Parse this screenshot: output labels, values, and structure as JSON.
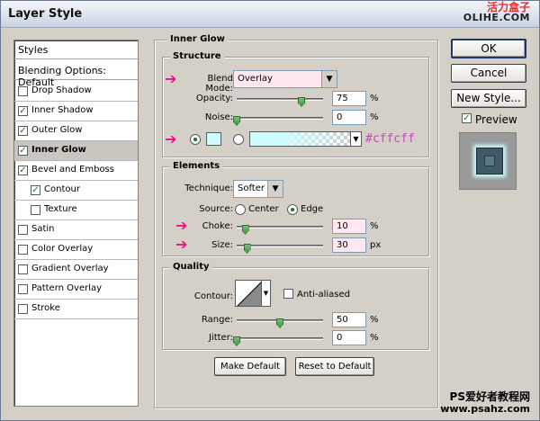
{
  "window": {
    "title": "Layer Style",
    "watermark_top_line1": "活力盒子",
    "watermark_top_line2": "OLIHE.COM",
    "watermark_bottom_line1": "PS爱好者教程网",
    "watermark_bottom_line2": "www.psahz.com"
  },
  "styles_list": {
    "header": "Styles",
    "blending_options": "Blending Options: Default",
    "items": [
      {
        "label": "Drop Shadow",
        "checked": false
      },
      {
        "label": "Inner Shadow",
        "checked": true
      },
      {
        "label": "Outer Glow",
        "checked": true
      },
      {
        "label": "Inner Glow",
        "checked": true,
        "active": true
      },
      {
        "label": "Bevel and Emboss",
        "checked": true
      },
      {
        "label": "Contour",
        "checked": true,
        "indent": true
      },
      {
        "label": "Texture",
        "checked": false,
        "indent": true
      },
      {
        "label": "Satin",
        "checked": false
      },
      {
        "label": "Color Overlay",
        "checked": false
      },
      {
        "label": "Gradient Overlay",
        "checked": false
      },
      {
        "label": "Pattern Overlay",
        "checked": false
      },
      {
        "label": "Stroke",
        "checked": false
      }
    ]
  },
  "inner_glow": {
    "title": "Inner Glow",
    "structure": {
      "title": "Structure",
      "blend_mode_label": "Blend Mode:",
      "blend_mode_value": "Overlay",
      "opacity_label": "Opacity:",
      "opacity_value": "75",
      "opacity_unit": "%",
      "opacity_fraction": 0.75,
      "noise_label": "Noise:",
      "noise_value": "0",
      "noise_unit": "%",
      "noise_fraction": 0,
      "color_hex_label": "#cffcff",
      "glow_color": "#cffcff"
    },
    "elements": {
      "title": "Elements",
      "technique_label": "Technique:",
      "technique_value": "Softer",
      "source_label": "Source:",
      "source_center": "Center",
      "source_edge": "Edge",
      "choke_label": "Choke:",
      "choke_value": "10",
      "choke_unit": "%",
      "choke_fraction": 0.1,
      "size_label": "Size:",
      "size_value": "30",
      "size_unit": "px",
      "size_fraction": 0.12
    },
    "quality": {
      "title": "Quality",
      "contour_label": "Contour:",
      "anti_aliased_label": "Anti-aliased",
      "range_label": "Range:",
      "range_value": "50",
      "range_unit": "%",
      "range_fraction": 0.5,
      "jitter_label": "Jitter:",
      "jitter_value": "0",
      "jitter_unit": "%",
      "jitter_fraction": 0
    },
    "make_default": "Make Default",
    "reset_to_default": "Reset to Default"
  },
  "buttons": {
    "ok": "OK",
    "cancel": "Cancel",
    "new_style": "New Style...",
    "preview_label": "Preview",
    "preview_checked": true
  },
  "colors": {
    "highlight_arrow": "#e8147f",
    "hex_text": "#cc40c8",
    "slider_thumb": "#3f8f3f"
  }
}
